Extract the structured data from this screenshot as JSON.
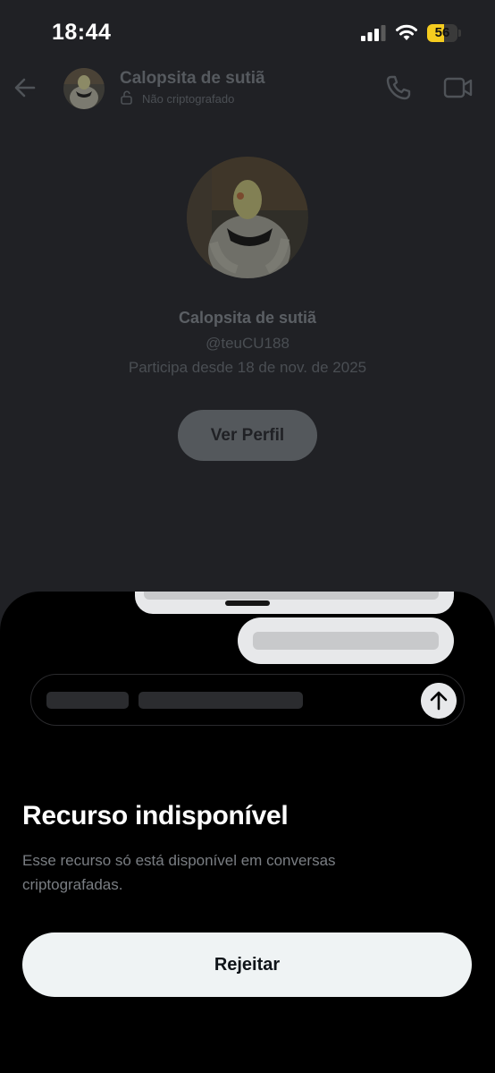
{
  "status_bar": {
    "time": "18:44",
    "battery": "56",
    "battery_level": 0.56,
    "icons": [
      "cellular-signal-icon",
      "wifi-icon",
      "battery-icon"
    ]
  },
  "header": {
    "name": "Calopsita de sutiã",
    "subtitle": "Não criptografado",
    "icons": [
      "back-arrow-icon",
      "unlocked-padlock-icon",
      "phone-icon",
      "video-camera-icon"
    ]
  },
  "profile": {
    "name": "Calopsita de sutiã",
    "handle": "@teuCU188",
    "joined": "Participa desde 18 de nov. de 2025",
    "view_profile_label": "Ver Perfil"
  },
  "sheet": {
    "title": "Recurso indisponível",
    "description": "Esse recurso só está disponível em conversas criptografadas.",
    "reject_label": "Rejeitar",
    "send_icon": "arrow-up-icon"
  },
  "colors": {
    "background": "#202125",
    "sheet_background": "#000000",
    "button_background": "#eff3f4",
    "battery_fill": "#f5cc1f"
  }
}
